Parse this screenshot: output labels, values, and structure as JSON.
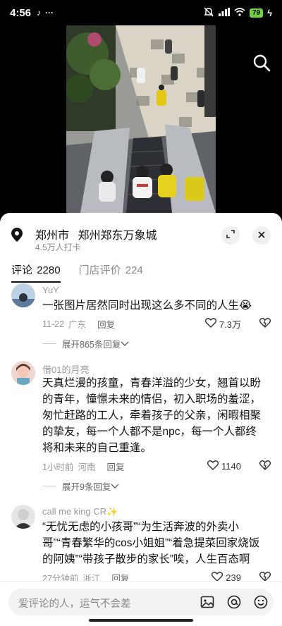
{
  "status": {
    "time": "4:56",
    "battery": "79"
  },
  "location": {
    "city": "郑州市",
    "name": "郑州郑东万象城",
    "checkins": "4.5万人打卡"
  },
  "tabs": [
    {
      "label": "评论",
      "count": "2280"
    },
    {
      "label": "门店评价",
      "count": "224"
    }
  ],
  "comments": [
    {
      "user": "YuY",
      "text": "一张图片居然同时出现这么多不同的人生😭",
      "date": "11-22",
      "region": "广东",
      "reply": "回复",
      "likes": "7.3万",
      "expand": "展开865条回复"
    },
    {
      "user": "借01的月亮",
      "text": "天真烂漫的孩童，青春洋溢的少女，翘首以盼的青年，憧憬未来的情侣，初入职场的羞涩，匆忙赶路的工人，牵着孩子的父亲，闲暇相聚的挚友，每一个人都不是npc，每一个人都终将和未来的自己重逢。",
      "date": "1小时前",
      "region": "河南",
      "reply": "回复",
      "likes": "1140",
      "expand": "展开9条回复"
    },
    {
      "user": "call  me   king  CR✨",
      "text": "“无忧无虑的小孩哥”“为生活奔波的外卖小哥”“青春繁华的cos小姐姐”“着急提菜回家烧饭的阿姨”“带孩子散步的家长”唉，人生百态啊",
      "date": "27分钟前",
      "region": "浙江",
      "reply": "回复",
      "likes": "239"
    }
  ],
  "input": {
    "placeholder": "爱评论的人，运气不会差"
  },
  "icons": {
    "status_left": [
      "tiktok-icon",
      "more-dots-icon"
    ],
    "status_right": [
      "mute-icon",
      "signal-icon",
      "wifi-icon",
      "battery-icon",
      "charging-icon"
    ],
    "actions": [
      "search-icon",
      "location-pin-icon",
      "expand-icon",
      "close-icon",
      "heart-icon",
      "dislike-icon",
      "chevron-down-icon",
      "image-icon",
      "at-icon",
      "emoji-icon"
    ]
  },
  "colors": {
    "battery": "#6fd13b",
    "text_primary": "#111111",
    "text_secondary": "#999999"
  }
}
